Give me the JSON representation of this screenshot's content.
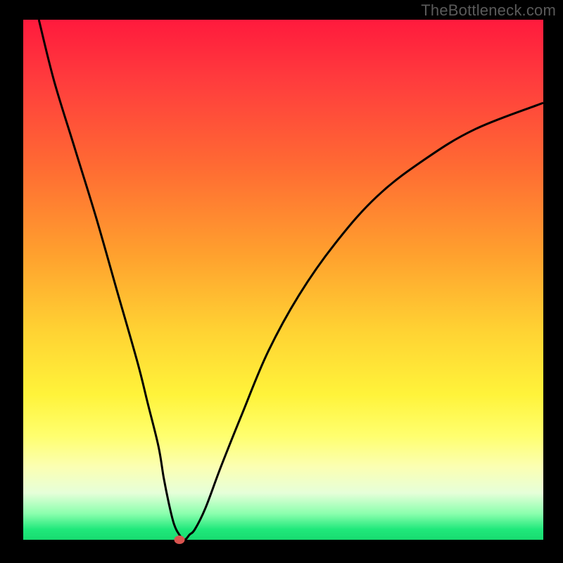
{
  "watermark": "TheBottleneck.com",
  "chart_data": {
    "type": "line",
    "title": "",
    "xlabel": "",
    "ylabel": "",
    "xlim": [
      0,
      100
    ],
    "ylim": [
      0,
      100
    ],
    "grid": false,
    "legend": false,
    "curve": {
      "x": [
        3,
        6,
        10,
        14,
        18,
        22,
        24,
        26,
        27,
        28,
        29,
        30,
        31,
        32,
        33,
        35,
        38,
        42,
        47,
        53,
        60,
        68,
        77,
        87,
        100
      ],
      "y": [
        100,
        88,
        75,
        62,
        48,
        34,
        26,
        18,
        12,
        7,
        3,
        1,
        0,
        1,
        2,
        6,
        14,
        24,
        36,
        47,
        57,
        66,
        73,
        79,
        84
      ]
    },
    "marker": {
      "x": 30,
      "y": 0,
      "color": "#d9544f"
    },
    "background_gradient": {
      "top": "#ff1a3d",
      "middle": "#ffd333",
      "bottom": "#18db70"
    }
  }
}
